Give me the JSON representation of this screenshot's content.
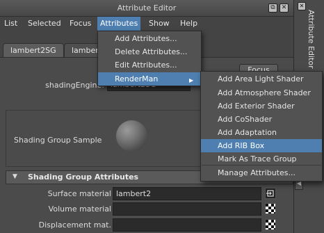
{
  "window": {
    "title": "Attribute Editor",
    "float_button": "⧉",
    "close_button": "✕",
    "dock_label": "Attribute Editor",
    "dock_close": "✕"
  },
  "menubar": {
    "items": [
      "List",
      "Selected",
      "Focus",
      "Attributes",
      "Show",
      "Help"
    ],
    "active": "Attributes"
  },
  "tabs": [
    "lambert2SG",
    "lamber"
  ],
  "focus_button": "Focus",
  "shading_engine": {
    "label": "shadingEngine:",
    "value": "lambert2SG"
  },
  "shading_group_sample": {
    "label": "Shading Group Sample"
  },
  "shading_group_section": {
    "title": "Shading Group Attributes",
    "rows": [
      {
        "label": "Surface material",
        "value": "lambert2"
      },
      {
        "label": "Volume material",
        "value": ""
      },
      {
        "label": "Displacement mat.",
        "value": ""
      }
    ]
  },
  "attributes_menu": {
    "items": [
      "Add Attributes...",
      "Delete Attributes...",
      "Edit Attributes...",
      "RenderMan"
    ],
    "active": "RenderMan",
    "submenu_arrow": "▶"
  },
  "renderman_menu": {
    "items": [
      "Add Area Light Shader",
      "Add Atmosphere Shader",
      "Add Exterior Shader",
      "Add CoShader",
      "Add Adaptation",
      "Add RIB Box",
      "Mark As Trace Group",
      "Manage Attributes..."
    ],
    "active": "Add RIB Box"
  },
  "colors": {
    "background": "#444444",
    "highlight": "#4e7fb0",
    "field": "#2b2b2b",
    "text": "#dcdcdc"
  },
  "icons": {
    "section_toggle": "▼",
    "side_arrow": "◀"
  }
}
